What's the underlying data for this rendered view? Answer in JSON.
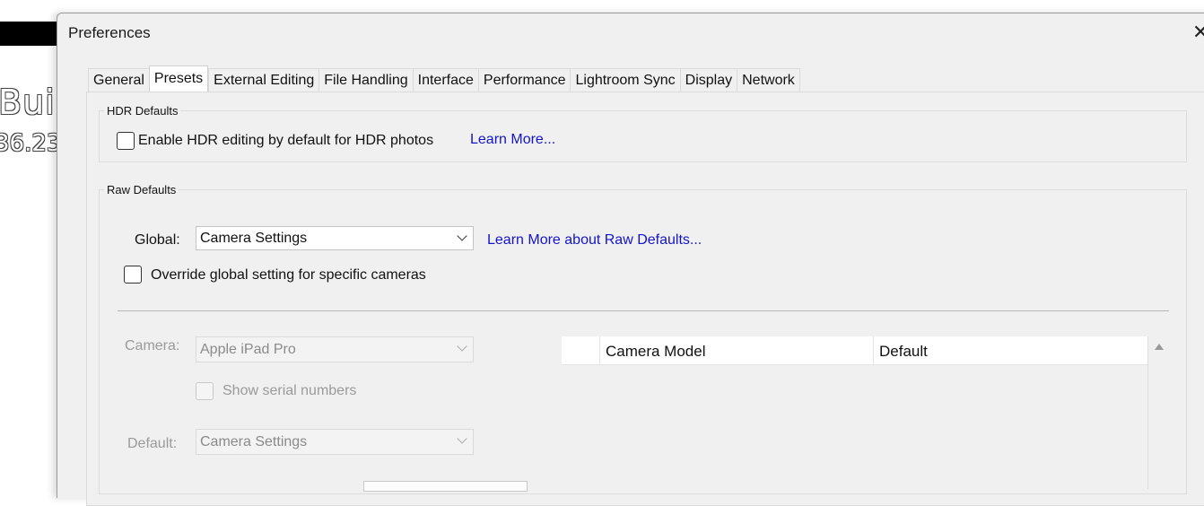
{
  "background": {
    "text1": "Bui",
    "text2": "36.23"
  },
  "dialog": {
    "title": "Preferences",
    "close_icon": "close-icon",
    "tabs": [
      {
        "label": "General"
      },
      {
        "label": "Presets",
        "active": true
      },
      {
        "label": "External Editing"
      },
      {
        "label": "File Handling"
      },
      {
        "label": "Interface"
      },
      {
        "label": "Performance"
      },
      {
        "label": "Lightroom Sync"
      },
      {
        "label": "Display"
      },
      {
        "label": "Network"
      }
    ]
  },
  "hdr": {
    "legend": "HDR Defaults",
    "checkbox_label": "Enable HDR editing by default for HDR photos",
    "checked": false,
    "link": "Learn More..."
  },
  "raw": {
    "legend": "Raw Defaults",
    "global_label": "Global:",
    "global_value": "Camera Settings",
    "link": "Learn More about Raw Defaults...",
    "override_label": "Override global setting for specific cameras",
    "override_checked": false,
    "camera_label": "Camera:",
    "camera_value": "Apple iPad Pro",
    "serial_label": "Show serial numbers",
    "default_label": "Default:",
    "default_value": "Camera Settings",
    "table": {
      "columns": [
        "",
        "Camera Model",
        "Default"
      ]
    }
  },
  "colors": {
    "link": "#1414c8",
    "dialog_bg": "#f0f0f0"
  }
}
